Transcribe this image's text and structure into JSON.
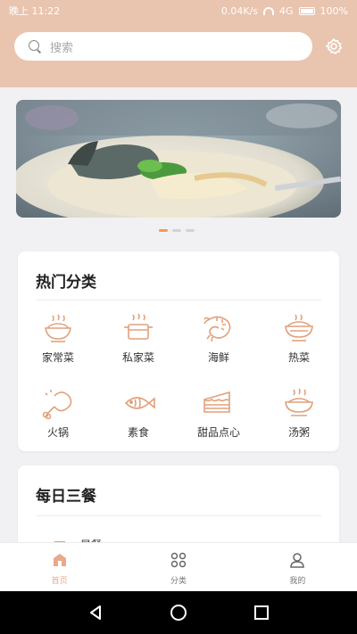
{
  "status_bar": {
    "time": "晚上 11:22",
    "network_speed": "0.04K/s",
    "network_type": "4G",
    "battery": "100%"
  },
  "search": {
    "placeholder": "搜索"
  },
  "banner": {
    "slide_count": 3,
    "active_slide": 1
  },
  "hot_categories": {
    "title": "热门分类",
    "items": [
      {
        "label": "家常菜",
        "icon": "food-bowl-icon"
      },
      {
        "label": "私家菜",
        "icon": "cooking-pot-icon"
      },
      {
        "label": "海鲜",
        "icon": "shrimp-icon"
      },
      {
        "label": "热菜",
        "icon": "hot-dish-icon"
      },
      {
        "label": "火锅",
        "icon": "drumstick-icon"
      },
      {
        "label": "素食",
        "icon": "fish-icon"
      },
      {
        "label": "甜品点心",
        "icon": "cake-icon"
      },
      {
        "label": "汤粥",
        "icon": "soup-bowl-icon"
      }
    ]
  },
  "daily_meals": {
    "title": "每日三餐",
    "first_item": "早餐"
  },
  "tabbar": {
    "items": [
      {
        "label": "首页",
        "icon": "home-icon",
        "active": true
      },
      {
        "label": "分类",
        "icon": "grid-icon",
        "active": false
      },
      {
        "label": "我的",
        "icon": "user-icon",
        "active": false
      }
    ]
  },
  "colors": {
    "header_bg": "#e9c4af",
    "accent": "#e9a98a",
    "page_bg": "#f1f1f3"
  }
}
